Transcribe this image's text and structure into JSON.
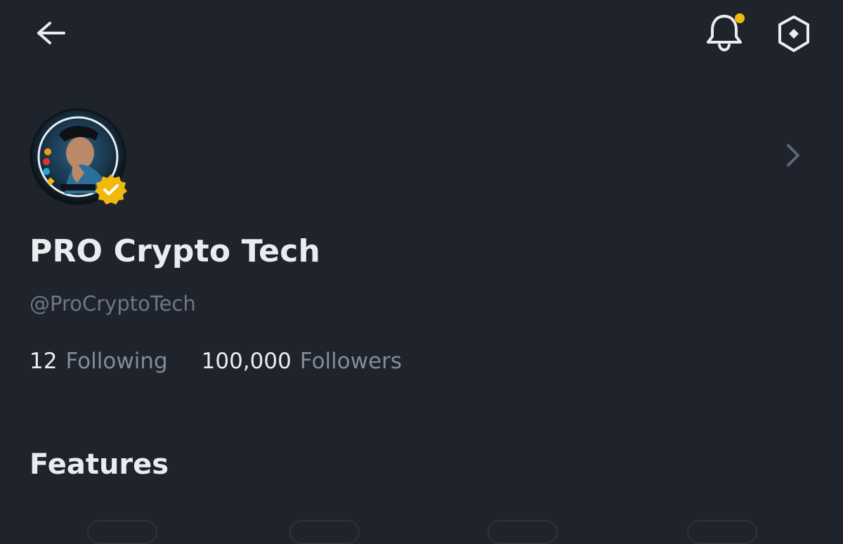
{
  "header": {
    "back_icon": "arrow-left-icon",
    "notification_icon": "bell-icon",
    "notification_dot_color": "#f0b90b",
    "settings_icon": "hexagon-icon"
  },
  "profile": {
    "avatar_icon": "avatar",
    "verified_badge_icon": "verified-badge-icon",
    "verified_color": "#f0b90b",
    "name": "PRO Crypto Tech",
    "handle": "@ProCryptoTech",
    "following_count": "12",
    "following_label": "Following",
    "followers_count": "100,000",
    "followers_label": "Followers",
    "more_icon": "chevron-right-icon"
  },
  "features": {
    "title": "Features"
  }
}
